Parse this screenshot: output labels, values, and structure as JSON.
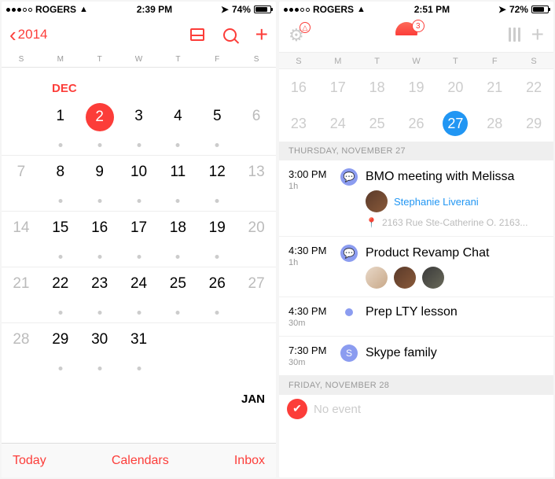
{
  "phoneA": {
    "status": {
      "carrier": "ROGERS",
      "time": "2:39 PM",
      "battery": "74%",
      "battery_level": 74
    },
    "nav": {
      "year": "2014"
    },
    "dow": [
      "S",
      "M",
      "T",
      "W",
      "T",
      "F",
      "S"
    ],
    "month_label": "DEC",
    "weeks": [
      [
        {
          "n": ""
        },
        {
          "n": "1",
          "e": 1
        },
        {
          "n": "2",
          "e": 1,
          "sel": 1
        },
        {
          "n": "3",
          "e": 1
        },
        {
          "n": "4",
          "e": 1
        },
        {
          "n": "5",
          "e": 1
        },
        {
          "n": "6",
          "wk": 1
        }
      ],
      [
        {
          "n": "7",
          "wk": 1
        },
        {
          "n": "8",
          "e": 1
        },
        {
          "n": "9",
          "e": 1
        },
        {
          "n": "10",
          "e": 1
        },
        {
          "n": "11",
          "e": 1
        },
        {
          "n": "12",
          "e": 1
        },
        {
          "n": "13",
          "wk": 1
        }
      ],
      [
        {
          "n": "14",
          "wk": 1
        },
        {
          "n": "15",
          "e": 1
        },
        {
          "n": "16",
          "e": 1
        },
        {
          "n": "17",
          "e": 1
        },
        {
          "n": "18",
          "e": 1
        },
        {
          "n": "19",
          "e": 1
        },
        {
          "n": "20",
          "wk": 1
        }
      ],
      [
        {
          "n": "21",
          "wk": 1
        },
        {
          "n": "22",
          "e": 1
        },
        {
          "n": "23",
          "e": 1
        },
        {
          "n": "24",
          "e": 1
        },
        {
          "n": "25",
          "e": 1
        },
        {
          "n": "26",
          "e": 1
        },
        {
          "n": "27",
          "wk": 1
        }
      ],
      [
        {
          "n": "28",
          "wk": 1
        },
        {
          "n": "29",
          "e": 1
        },
        {
          "n": "30",
          "e": 1
        },
        {
          "n": "31",
          "e": 1
        },
        {
          "n": ""
        },
        {
          "n": ""
        },
        {
          "n": ""
        }
      ]
    ],
    "next_month_label": "JAN",
    "toolbar": {
      "today": "Today",
      "calendars": "Calendars",
      "inbox": "Inbox"
    }
  },
  "phoneB": {
    "status": {
      "carrier": "ROGERS",
      "time": "2:51 PM",
      "battery": "72%",
      "battery_level": 72
    },
    "badge_count": "3",
    "dow": [
      "S",
      "M",
      "T",
      "W",
      "T",
      "F",
      "S"
    ],
    "weeks": [
      [
        {
          "n": "16"
        },
        {
          "n": "17"
        },
        {
          "n": "18"
        },
        {
          "n": "19"
        },
        {
          "n": "20"
        },
        {
          "n": "21"
        },
        {
          "n": "22"
        }
      ],
      [
        {
          "n": "23"
        },
        {
          "n": "24"
        },
        {
          "n": "25"
        },
        {
          "n": "26"
        },
        {
          "n": "27",
          "sel": 1
        },
        {
          "n": "28"
        },
        {
          "n": "29"
        }
      ]
    ],
    "sections": [
      {
        "header": "THURSDAY, NOVEMBER 27",
        "events": [
          {
            "time": "3:00 PM",
            "dur": "1h",
            "icon": "chat",
            "title": "BMO meeting with Melissa",
            "attendees": [
              {
                "name": "Stephanie Liverani",
                "avatar": "a1"
              }
            ],
            "location": "2163 Rue Ste-Catherine O. 2163..."
          },
          {
            "time": "4:30 PM",
            "dur": "1h",
            "icon": "chat",
            "title": "Product Revamp Chat",
            "avatars": [
              "a2",
              "a1",
              "a3"
            ]
          },
          {
            "time": "4:30 PM",
            "dur": "30m",
            "icon": "dot",
            "title": "Prep LTY lesson"
          },
          {
            "time": "7:30 PM",
            "dur": "30m",
            "icon": "skype",
            "title": "Skype family"
          }
        ]
      },
      {
        "header": "FRIDAY, NOVEMBER 28",
        "no_event": "No event"
      }
    ]
  }
}
